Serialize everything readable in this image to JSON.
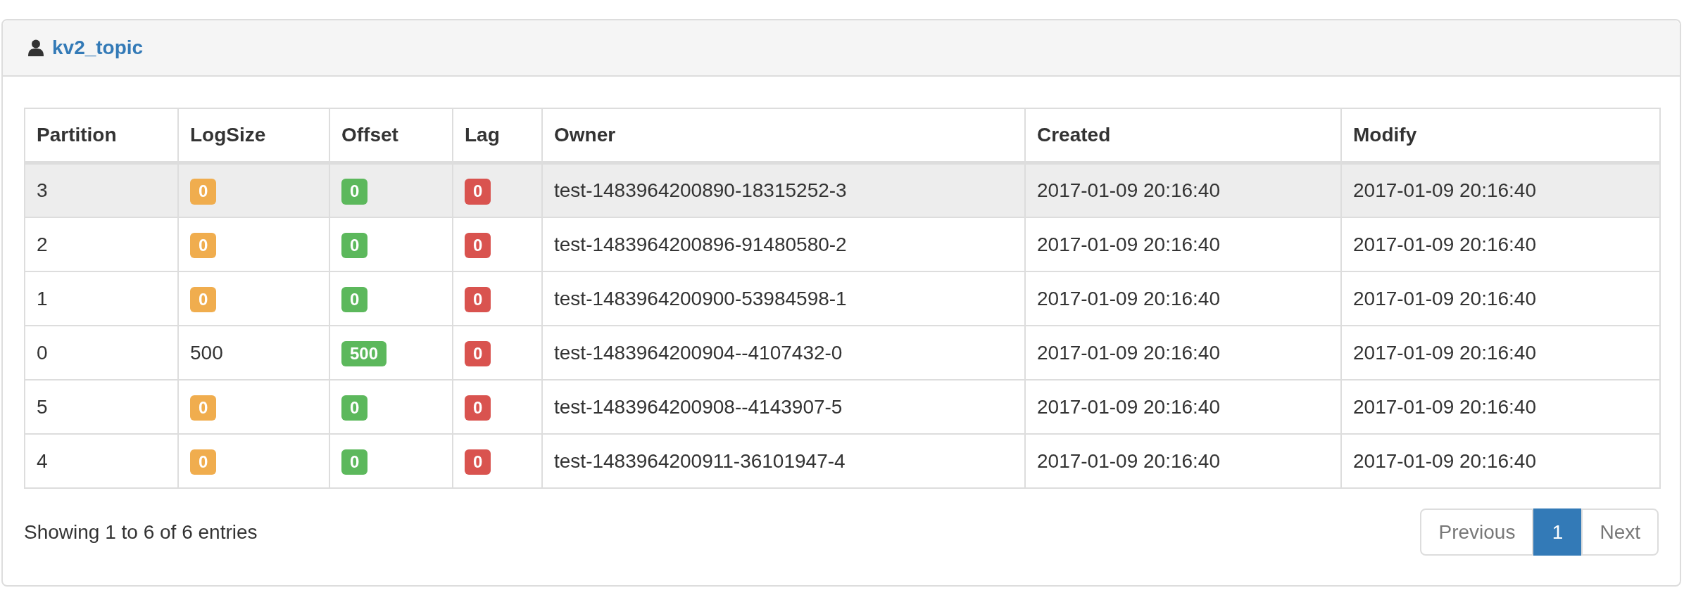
{
  "panel": {
    "title": "kv2_topic"
  },
  "table": {
    "columns": [
      "Partition",
      "LogSize",
      "Offset",
      "Lag",
      "Owner",
      "Created",
      "Modify"
    ],
    "rows": [
      {
        "highlighted": true,
        "cells": [
          {
            "kind": "plain",
            "text": "3"
          },
          {
            "kind": "warning",
            "text": "0"
          },
          {
            "kind": "success",
            "text": "0"
          },
          {
            "kind": "danger",
            "text": "0"
          },
          {
            "kind": "plain",
            "text": "test-1483964200890-18315252-3"
          },
          {
            "kind": "plain",
            "text": "2017-01-09 20:16:40"
          },
          {
            "kind": "plain",
            "text": "2017-01-09 20:16:40"
          }
        ]
      },
      {
        "highlighted": false,
        "cells": [
          {
            "kind": "plain",
            "text": "2"
          },
          {
            "kind": "warning",
            "text": "0"
          },
          {
            "kind": "success",
            "text": "0"
          },
          {
            "kind": "danger",
            "text": "0"
          },
          {
            "kind": "plain",
            "text": "test-1483964200896-91480580-2"
          },
          {
            "kind": "plain",
            "text": "2017-01-09 20:16:40"
          },
          {
            "kind": "plain",
            "text": "2017-01-09 20:16:40"
          }
        ]
      },
      {
        "highlighted": false,
        "cells": [
          {
            "kind": "plain",
            "text": "1"
          },
          {
            "kind": "warning",
            "text": "0"
          },
          {
            "kind": "success",
            "text": "0"
          },
          {
            "kind": "danger",
            "text": "0"
          },
          {
            "kind": "plain",
            "text": "test-1483964200900-53984598-1"
          },
          {
            "kind": "plain",
            "text": "2017-01-09 20:16:40"
          },
          {
            "kind": "plain",
            "text": "2017-01-09 20:16:40"
          }
        ]
      },
      {
        "highlighted": false,
        "cells": [
          {
            "kind": "plain",
            "text": "0"
          },
          {
            "kind": "plain",
            "text": "500"
          },
          {
            "kind": "success",
            "text": "500"
          },
          {
            "kind": "danger",
            "text": "0"
          },
          {
            "kind": "plain",
            "text": "test-1483964200904--4107432-0"
          },
          {
            "kind": "plain",
            "text": "2017-01-09 20:16:40"
          },
          {
            "kind": "plain",
            "text": "2017-01-09 20:16:40"
          }
        ]
      },
      {
        "highlighted": false,
        "cells": [
          {
            "kind": "plain",
            "text": "5"
          },
          {
            "kind": "warning",
            "text": "0"
          },
          {
            "kind": "success",
            "text": "0"
          },
          {
            "kind": "danger",
            "text": "0"
          },
          {
            "kind": "plain",
            "text": "test-1483964200908--4143907-5"
          },
          {
            "kind": "plain",
            "text": "2017-01-09 20:16:40"
          },
          {
            "kind": "plain",
            "text": "2017-01-09 20:16:40"
          }
        ]
      },
      {
        "highlighted": false,
        "cells": [
          {
            "kind": "plain",
            "text": "4"
          },
          {
            "kind": "warning",
            "text": "0"
          },
          {
            "kind": "success",
            "text": "0"
          },
          {
            "kind": "danger",
            "text": "0"
          },
          {
            "kind": "plain",
            "text": "test-1483964200911-36101947-4"
          },
          {
            "kind": "plain",
            "text": "2017-01-09 20:16:40"
          },
          {
            "kind": "plain",
            "text": "2017-01-09 20:16:40"
          }
        ]
      }
    ]
  },
  "info": "Showing 1 to 6 of 6 entries",
  "pagination": {
    "previous": "Previous",
    "next": "Next",
    "pages": [
      {
        "label": "1",
        "selected": true
      }
    ]
  }
}
